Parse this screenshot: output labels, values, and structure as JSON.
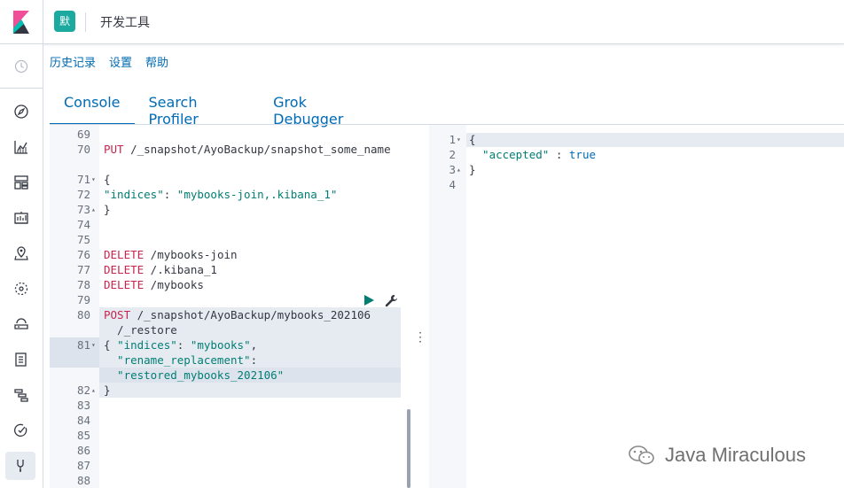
{
  "header": {
    "space_initial": "默",
    "title": "开发工具"
  },
  "nav": {
    "icons": [
      "clock-icon",
      "compass-icon",
      "visualize-icon",
      "dashboard-icon",
      "canvas-icon",
      "maps-icon",
      "ml-icon",
      "infrastructure-icon",
      "logs-icon",
      "apm-icon",
      "uptime-icon",
      "devtools-icon"
    ]
  },
  "top_menu": {
    "history": "历史记录",
    "settings": "设置",
    "help": "帮助"
  },
  "tabs": {
    "console": "Console",
    "search_profiler": "Search Profiler",
    "grok_debugger": "Grok Debugger"
  },
  "request_editor": {
    "lines": [
      {
        "n": "69"
      },
      {
        "n": "70",
        "method": "PUT",
        "url": " /_snapshot/AyoBackup/snapshot_some_name"
      },
      {
        "n": ""
      },
      {
        "n": "71",
        "fold": "▾",
        "text": "{"
      },
      {
        "n": "72",
        "key": "\"indices\"",
        "punct": ": ",
        "str": "\"mybooks-join,.kibana_1\""
      },
      {
        "n": "73",
        "fold": "▴",
        "text": "}"
      },
      {
        "n": "74"
      },
      {
        "n": "75"
      },
      {
        "n": "76",
        "method": "DELETE",
        "url": " /mybooks-join"
      },
      {
        "n": "77",
        "method": "DELETE",
        "url": " /.kibana_1"
      },
      {
        "n": "78",
        "method": "DELETE",
        "url": " /mybooks"
      },
      {
        "n": "79"
      },
      {
        "n": "80",
        "method": "POST",
        "url": " /_snapshot/AyoBackup/mybooks_202106"
      },
      {
        "n": "",
        "url": "  /_restore"
      },
      {
        "n": "81",
        "fold": "▾",
        "text": "{ ",
        "key": "\"indices\"",
        "punct": ": ",
        "str": "\"mybooks\"",
        "tail": ","
      },
      {
        "n": "",
        "key": "  \"rename_replacement\"",
        "punct": ":"
      },
      {
        "n": "",
        "str": "  \"restored_mybooks_202106\""
      },
      {
        "n": "82",
        "fold": "▴",
        "text": "}"
      },
      {
        "n": "83"
      },
      {
        "n": "84"
      },
      {
        "n": "85"
      },
      {
        "n": "86"
      },
      {
        "n": "87"
      },
      {
        "n": "88"
      }
    ]
  },
  "response_editor": {
    "lines": [
      {
        "n": "1",
        "fold": "▾",
        "text": "{"
      },
      {
        "n": "2",
        "key": "  \"accepted\"",
        "punct": " : ",
        "bool": "true"
      },
      {
        "n": "3",
        "fold": "▴",
        "text": "}"
      },
      {
        "n": "4"
      }
    ]
  },
  "watermark": {
    "text": "Java Miraculous"
  },
  "colors": {
    "accent": "#006bb4",
    "method": "#c7254e",
    "string": "#017d73",
    "highlight": "#e6ebf2",
    "badge": "#1ba9a0"
  }
}
